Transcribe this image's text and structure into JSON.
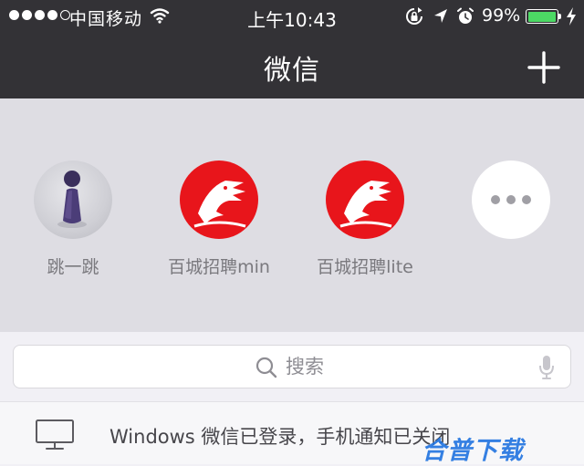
{
  "status_bar": {
    "carrier": "中国移动",
    "time": "上午10:43",
    "battery": "99%",
    "battery_level": 0.99,
    "icons": [
      "signal-dots",
      "wifi-icon",
      "rotation-lock-icon",
      "location-icon",
      "alarm-icon",
      "battery-icon",
      "charging-icon"
    ]
  },
  "nav": {
    "title": "微信",
    "add_icon": "plus-icon"
  },
  "mini_programs": [
    {
      "label": "跳一跳",
      "icon": "jump-jump-icon"
    },
    {
      "label": "百城招聘min",
      "icon": "horse-logo-icon"
    },
    {
      "label": "百城招聘lite",
      "icon": "horse-logo-icon"
    },
    {
      "label": "",
      "icon": "more-icon"
    }
  ],
  "search": {
    "placeholder": "搜索",
    "icon": "search-icon",
    "voice_icon": "microphone-icon"
  },
  "notice": {
    "text": "Windows 微信已登录，手机通知已关闭",
    "icon": "monitor-icon"
  },
  "watermark": "合普下载",
  "colors": {
    "nav_bg": "#333236",
    "panel_bg": "#dedde3",
    "brand_red": "#e8151b",
    "battery_green": "#4cd964"
  }
}
